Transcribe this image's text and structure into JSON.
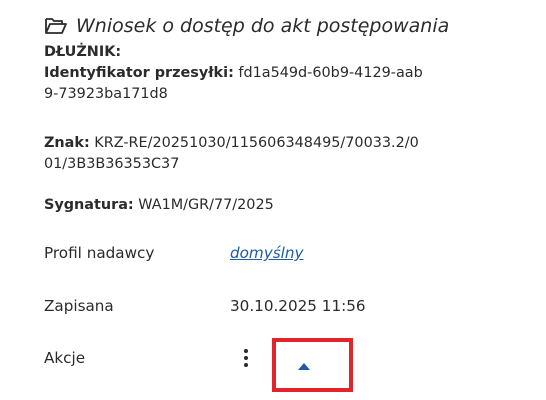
{
  "header": {
    "title": "Wniosek o dostęp do akt postępowania",
    "icon": "folder-open-icon"
  },
  "details": {
    "debtor_label": "DŁUŻNIK:",
    "shipment_id_label": "Identyfikator przesyłki:",
    "shipment_id_value_line1": " fd1a549d-60b9-4129-aab",
    "shipment_id_value_line2": "9-73923ba171d8",
    "sign_label": "Znak:",
    "sign_value_line1": " KRZ-RE/20251030/115606348495/70033.2/0",
    "sign_value_line2": "01/3B3B36353C37",
    "signature_label": "Sygnatura:",
    "signature_value": " WA1M/GR/77/2025"
  },
  "rows": {
    "sender_profile_label": "Profil nadawcy",
    "sender_profile_value": "domyślny",
    "saved_label": "Zapisana",
    "saved_value": "30.10.2025 11:56",
    "actions_label": "Akcje"
  },
  "actions": {
    "more_icon": "kebab-menu-icon",
    "expand_icon": "caret-up-icon",
    "highlight_color": "#e3232a"
  }
}
